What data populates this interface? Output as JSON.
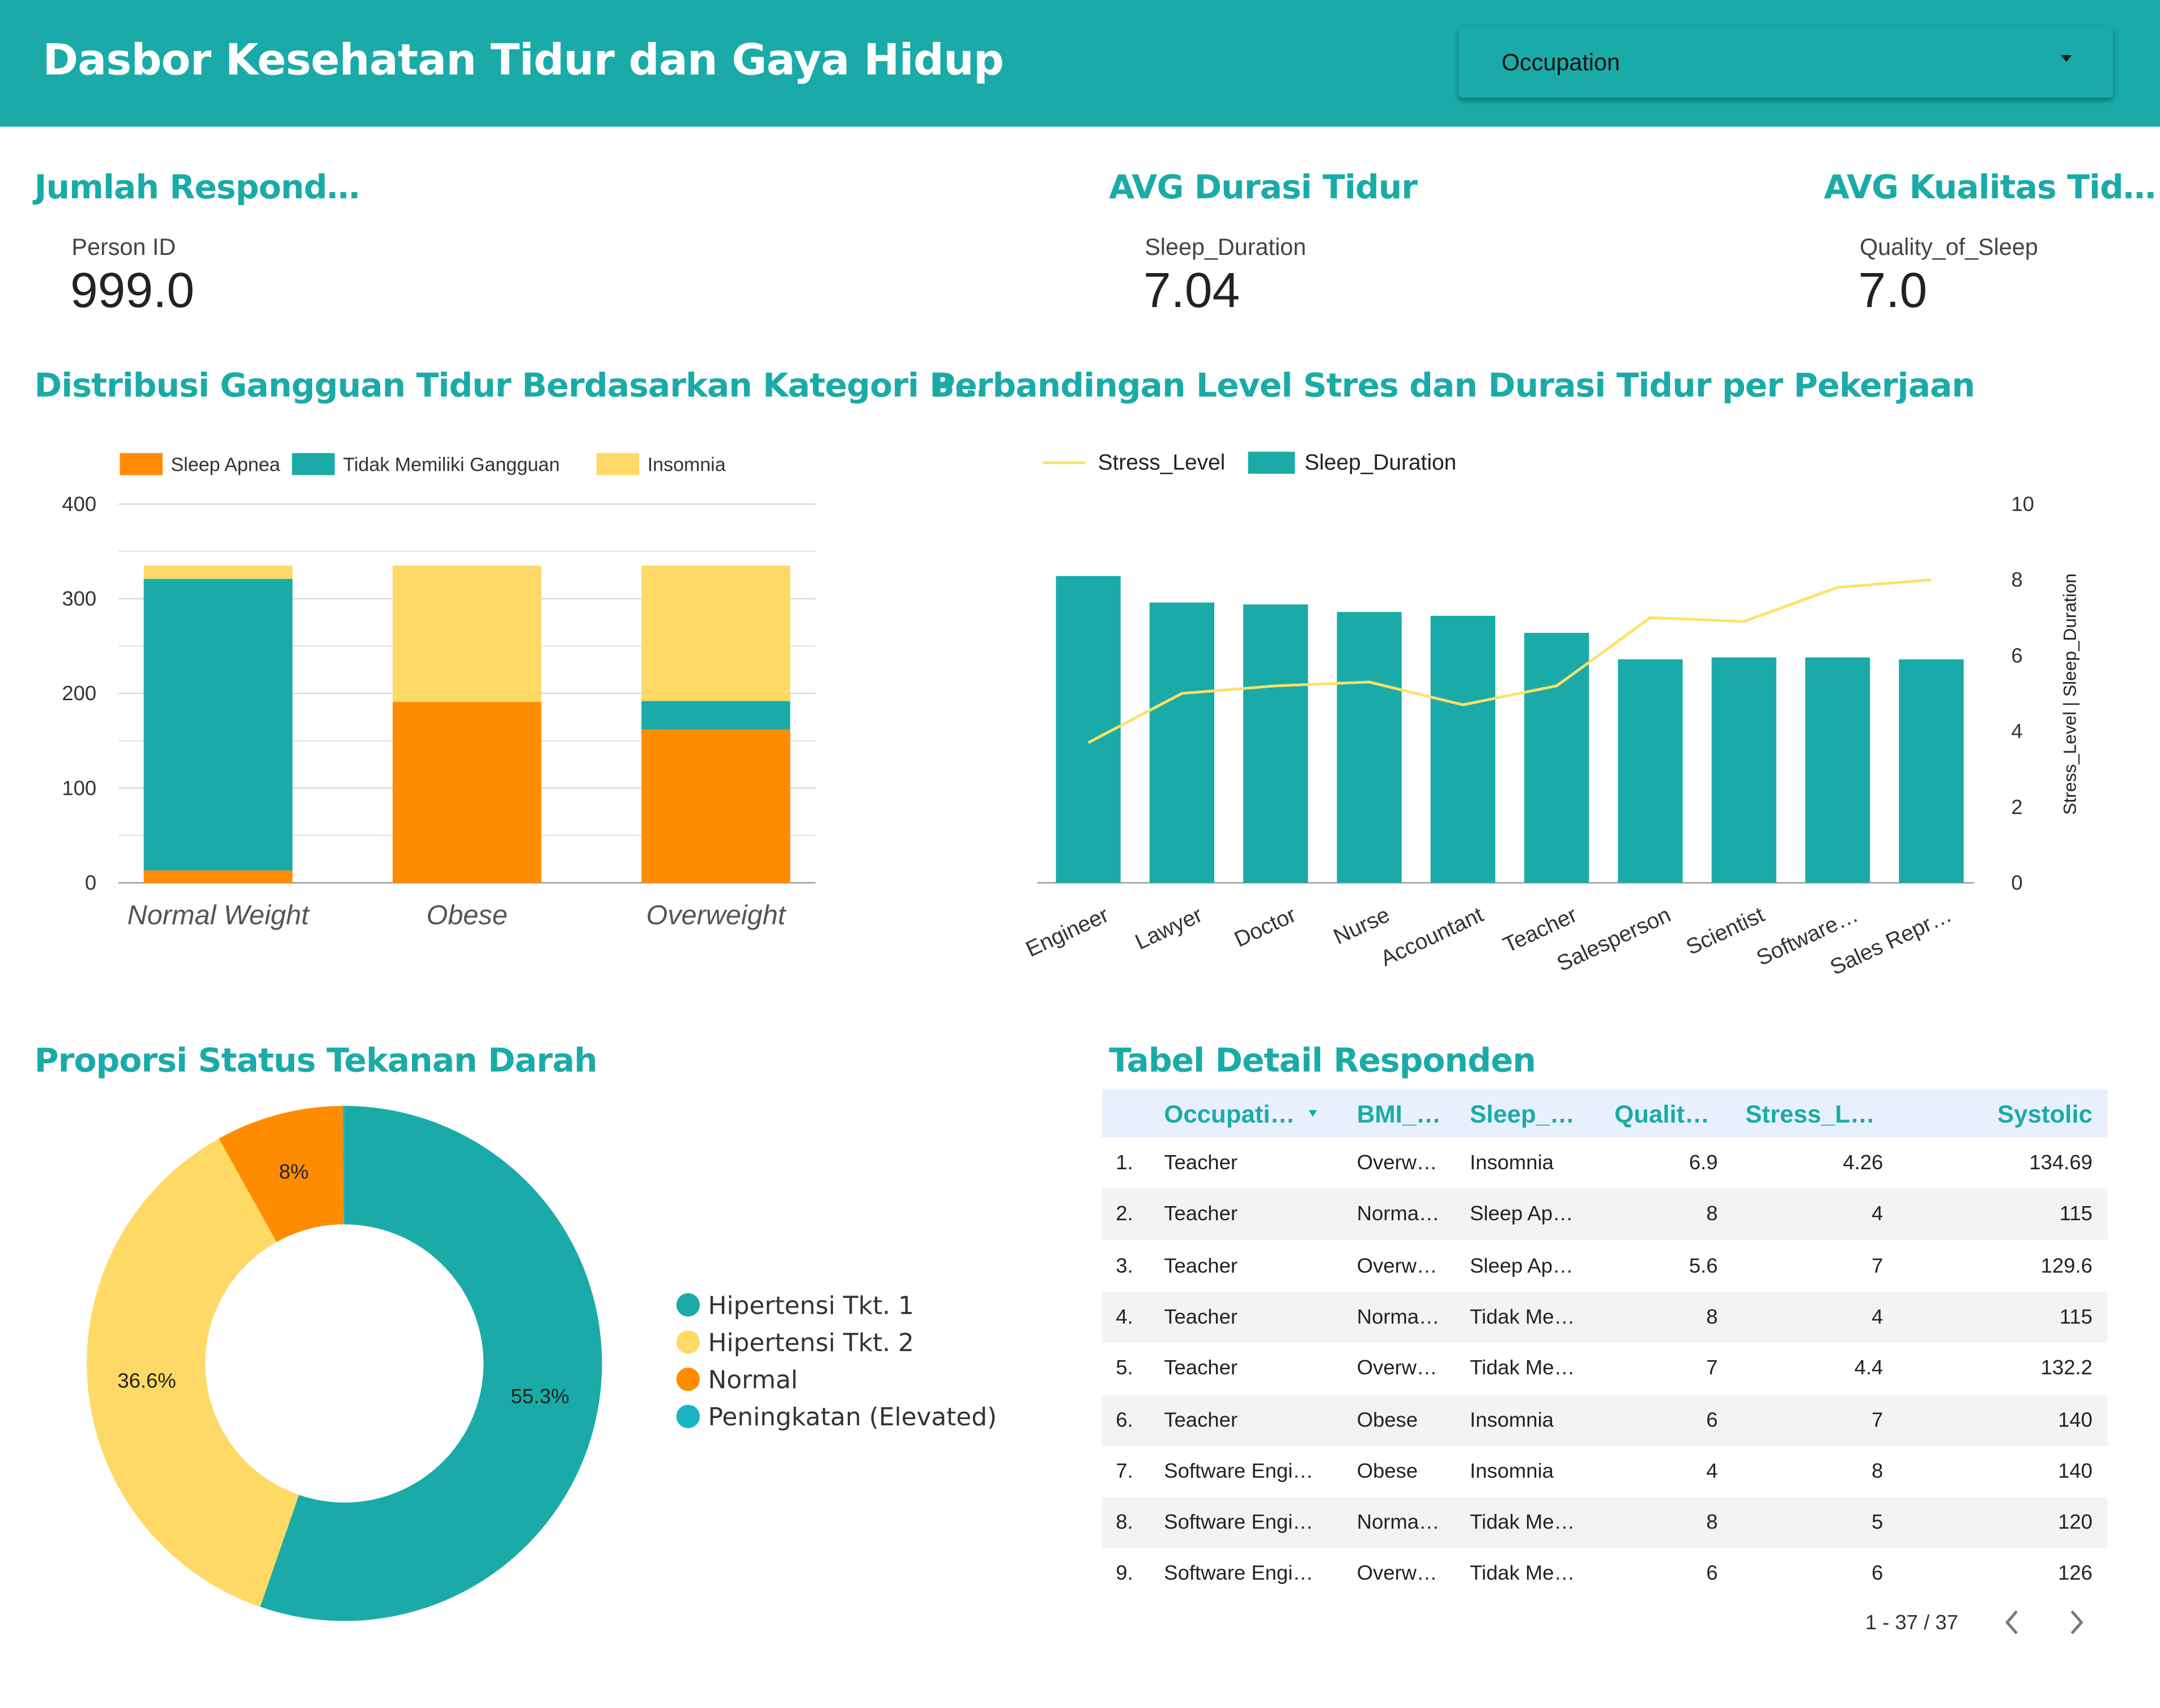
{
  "header": {
    "title": "Dasbor Kesehatan Tidur dan Gaya Hidup",
    "dropdown_label": "Occupation"
  },
  "kpis": [
    {
      "title": "Jumlah Respond…",
      "label": "Person ID",
      "value": "999.0"
    },
    {
      "title": "AVG Durasi Tidur",
      "label": "Sleep_Duration",
      "value": "7.04"
    },
    {
      "title": "AVG Kualitas Tid…",
      "label": "Quality_of_Sleep",
      "value": "7.0"
    }
  ],
  "colors": {
    "accent": "#1aaba8",
    "orange": "#ff8c00",
    "yellow": "#ffd966",
    "cyan": "#19b5c6",
    "line": "#fde068"
  },
  "chart_data": [
    {
      "type": "bar",
      "stacked": true,
      "title": "Distribusi Gangguan Tidur Berdasarkan Kategori B…",
      "categories": [
        "Normal Weight",
        "Obese",
        "Overweight"
      ],
      "series": [
        {
          "name": "Sleep Apnea",
          "values": [
            13,
            191,
            162
          ],
          "color": "#ff8c00"
        },
        {
          "name": "Tidak Memiliki Gangguan",
          "values": [
            308,
            0,
            30
          ],
          "color": "#1aaba8"
        },
        {
          "name": "Insomnia",
          "values": [
            14,
            144,
            143
          ],
          "color": "#ffd966"
        }
      ],
      "yticks": [
        0,
        100,
        200,
        300,
        400
      ],
      "ylim": [
        0,
        400
      ],
      "legend": "top"
    },
    {
      "type": "bar",
      "title": "Perbandingan Level Stres dan Durasi Tidur per Pekerjaan",
      "categories": [
        "Engineer",
        "Lawyer",
        "Doctor",
        "Nurse",
        "Accountant",
        "Teacher",
        "Salesperson",
        "Scientist",
        "Software…",
        "Sales Repr…"
      ],
      "series": [
        {
          "name": "Stress_Level",
          "type": "line",
          "values": [
            3.7,
            5.0,
            5.2,
            5.3,
            4.7,
            5.2,
            7.0,
            6.9,
            7.8,
            8.0
          ],
          "color": "#fde068"
        },
        {
          "name": "Sleep_Duration",
          "type": "bar",
          "values": [
            8.1,
            7.4,
            7.35,
            7.15,
            7.05,
            6.6,
            5.9,
            5.95,
            5.95,
            5.9
          ],
          "color": "#1aaba8"
        }
      ],
      "ylabel": "Stress_Level | Sleep_Duration",
      "yticks": [
        0,
        2,
        4,
        6,
        8,
        10
      ],
      "ylim": [
        0,
        10
      ],
      "legend": "top-left"
    },
    {
      "type": "pie",
      "donut": true,
      "title": "Proporsi Status Tekanan Darah",
      "labels": [
        "Hipertensi Tkt. 1",
        "Hipertensi Tkt. 2",
        "Normal",
        "Peningkatan (Elevated)"
      ],
      "values": [
        55.3,
        36.6,
        8,
        0.1
      ],
      "value_labels": [
        "55.3%",
        "36.6%",
        "8%",
        ""
      ],
      "colors": [
        "#1aaba8",
        "#ffd966",
        "#ff8c00",
        "#19b5c6"
      ],
      "legend": "right"
    },
    {
      "type": "table",
      "title": "Tabel Detail Responden",
      "columns": [
        "Occupati…",
        "BMI_…",
        "Sleep_…",
        "Qualit…",
        "Stress_L…",
        "Systolic"
      ],
      "rows": [
        [
          "1.",
          "Teacher",
          "Overw…",
          "Insomnia",
          "6.9",
          "4.26",
          "134.69"
        ],
        [
          "2.",
          "Teacher",
          "Norma…",
          "Sleep Ap…",
          "8",
          "4",
          "115"
        ],
        [
          "3.",
          "Teacher",
          "Overw…",
          "Sleep Ap…",
          "5.6",
          "7",
          "129.6"
        ],
        [
          "4.",
          "Teacher",
          "Norma…",
          "Tidak Me…",
          "8",
          "4",
          "115"
        ],
        [
          "5.",
          "Teacher",
          "Overw…",
          "Tidak Me…",
          "7",
          "4.4",
          "132.2"
        ],
        [
          "6.",
          "Teacher",
          "Obese",
          "Insomnia",
          "6",
          "7",
          "140"
        ],
        [
          "7.",
          "Software Engi…",
          "Obese",
          "Insomnia",
          "4",
          "8",
          "140"
        ],
        [
          "8.",
          "Software Engi…",
          "Norma…",
          "Tidak Me…",
          "8",
          "5",
          "120"
        ],
        [
          "9.",
          "Software Engi…",
          "Overw…",
          "Tidak Me…",
          "6",
          "6",
          "126"
        ]
      ],
      "pagination": "1 - 37 / 37"
    }
  ]
}
